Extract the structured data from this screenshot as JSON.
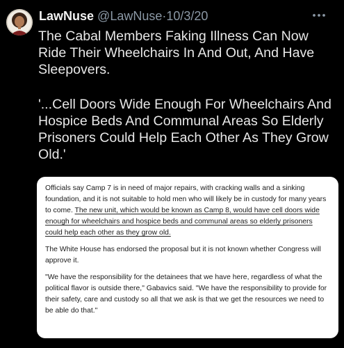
{
  "tweet": {
    "display_name": "LawNuse",
    "handle": "@LawNuse",
    "separator": "·",
    "date": "10/3/20",
    "text_line1": "The Cabal Members Faking Illness Can Now Ride Their Wheelchairs In And Out, And Have Sleepovers.",
    "text_quote": "'...Cell Doors Wide Enough For Wheelchairs And Hospice Beds And Communal Areas So Elderly Prisoners Could Help Each Other As They Grow Old.'"
  },
  "article": {
    "p1_plain": "Officials say Camp 7 is in need of major repairs, with cracking walls and a sinking foundation, and it is not suitable to hold men who will likely be in custody for many years to come. ",
    "p1_underlined": "The new unit, which would be known as Camp 8, would have cell doors wide enough for wheelchairs and hospice beds and communal areas so elderly prisoners could help each other as they grow old.",
    "p2": "The White House has endorsed the proposal but it is not known whether Congress will approve it.",
    "p3": "\"We have the responsibility for the detainees that we have here, regardless of what the political flavor is outside there,\" Gabavics said. \"We have the responsibility to provide for their safety, care and custody so all that we ask is that we get the resources we need to be able do that.\""
  },
  "icons": {
    "avatar": "profile-avatar",
    "more": "more-options-icon"
  },
  "colors": {
    "background": "#000000",
    "primary_text": "#e7e9ea",
    "secondary_text": "#8b98a5",
    "media_bg": "#ffffff"
  }
}
